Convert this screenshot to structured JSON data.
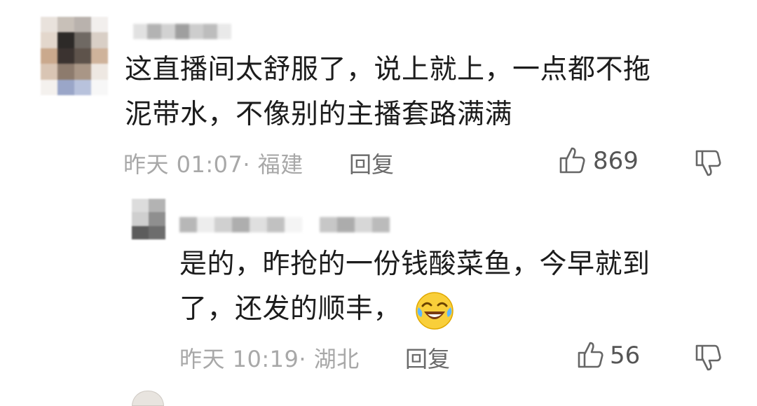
{
  "comments": [
    {
      "text": "这直播间太舒服了，说上就上，一点都不拖泥带水，不像别的主播套路满满",
      "line1": "这直播间太舒服了，说上就上，一点都不拖",
      "line2": "泥带水，不像别的主播套路满满",
      "time_location": "昨天 01:07· 福建",
      "reply_label": "回复",
      "likes": "869",
      "replies": [
        {
          "line1": "是的，昨抢的一份钱酸菜鱼，今早就到",
          "line2": "了，还发的顺丰，",
          "emoji": "laughing-crying-emoji",
          "time_location": "昨天 10:19· 湖北",
          "reply_label": "回复",
          "likes": "56"
        }
      ]
    }
  ],
  "icons": {
    "like": "thumbs-up-icon",
    "dislike": "thumbs-down-icon"
  },
  "colors": {
    "text": "#1c1c1c",
    "meta": "#a8a8a8",
    "reply": "#6a6a6a"
  }
}
